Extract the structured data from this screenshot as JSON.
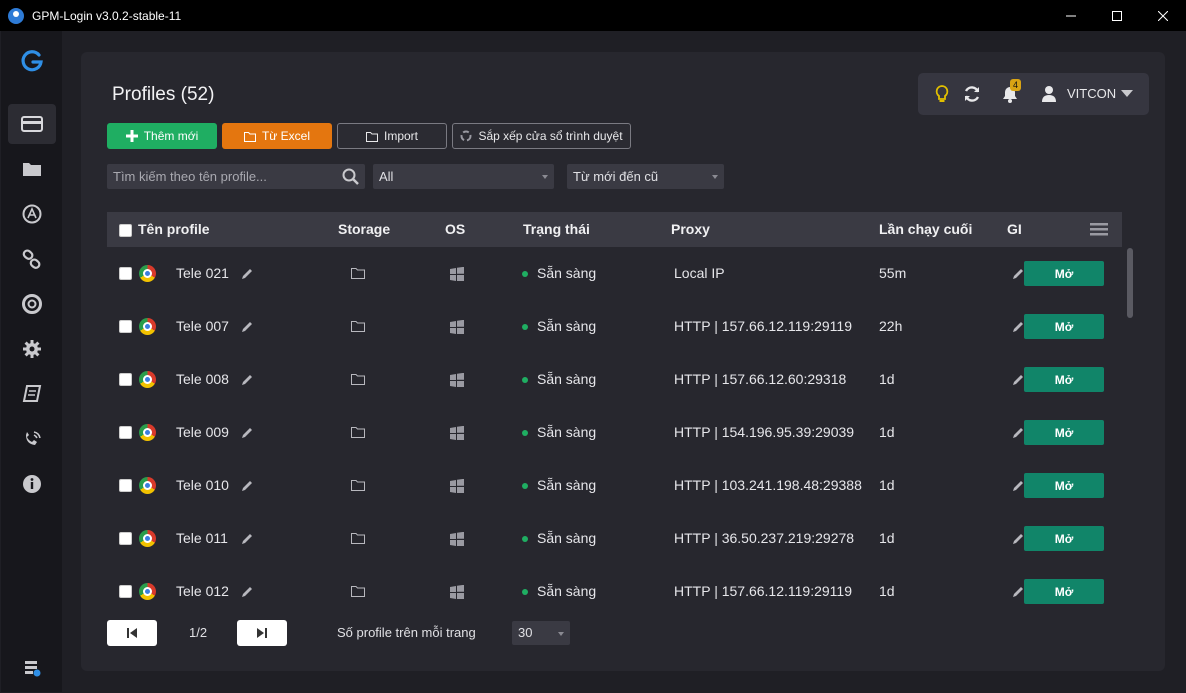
{
  "window": {
    "title": "GPM-Login v3.0.2-stable-11"
  },
  "page": {
    "title": "Profiles (52)"
  },
  "header": {
    "notification_count": "4",
    "user_name": "VITCON"
  },
  "toolbar": {
    "add_label": "Thêm mới",
    "excel_label": "Từ Excel",
    "import_label": "Import",
    "sort_label": "Sắp xếp cửa sổ trình duyệt"
  },
  "filters": {
    "search_placeholder": "Tìm kiếm theo tên profile...",
    "group_value": "All",
    "order_value": "Từ mới đến cũ"
  },
  "table": {
    "columns": [
      "Tên profile",
      "Storage",
      "OS",
      "Trạng thái",
      "Proxy",
      "Lần chạy cuối",
      "GI"
    ],
    "rows": [
      {
        "name": "Tele 021",
        "status": "Sẵn sàng",
        "proxy": "Local IP",
        "last_run": "55m",
        "action": "Mở"
      },
      {
        "name": "Tele 007",
        "status": "Sẵn sàng",
        "proxy": "HTTP | 157.66.12.119:29119",
        "last_run": "22h",
        "action": "Mở"
      },
      {
        "name": "Tele 008",
        "status": "Sẵn sàng",
        "proxy": "HTTP | 157.66.12.60:29318",
        "last_run": "1d",
        "action": "Mở"
      },
      {
        "name": "Tele 009",
        "status": "Sẵn sàng",
        "proxy": "HTTP | 154.196.95.39:29039",
        "last_run": "1d",
        "action": "Mở"
      },
      {
        "name": "Tele 010",
        "status": "Sẵn sàng",
        "proxy": "HTTP | 103.241.198.48:29388",
        "last_run": "1d",
        "action": "Mở"
      },
      {
        "name": "Tele 011",
        "status": "Sẵn sàng",
        "proxy": "HTTP | 36.50.237.219:29278",
        "last_run": "1d",
        "action": "Mở"
      },
      {
        "name": "Tele 012",
        "status": "Sẵn sàng",
        "proxy": "HTTP | 157.66.12.119:29119",
        "last_run": "1d",
        "action": "Mở"
      }
    ]
  },
  "pagination": {
    "page": "1/2",
    "per_page_label": "Số profile trên mỗi trang",
    "per_page_value": "30"
  }
}
